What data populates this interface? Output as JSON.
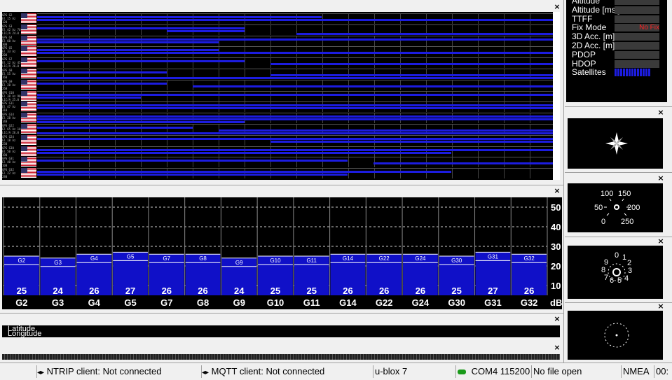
{
  "colors": {
    "signal_bar": "#1c1ce0",
    "snr_bar": "#1010c8",
    "fix_warning": "#ff2020",
    "background": "#000000"
  },
  "timeline": {
    "rows": [
      {
        "name": "GPS G2",
        "lines": [
          "GPS G2",
          "El 15 Az 120",
          "L1C/A 25.0"
        ],
        "bars": [
          [
            0,
            0.55
          ],
          [
            0,
            1
          ]
        ]
      },
      {
        "name": "GPS G3",
        "lines": [
          "GPS G3",
          "El 42 Az 70",
          "L1C/A 24.0"
        ],
        "bars": [
          [
            0,
            0.4
          ],
          [
            0.25,
            0.4
          ],
          [
            0.5,
            1
          ]
        ]
      },
      {
        "name": "GPS G4",
        "lines": [
          "GPS G4",
          "El 60 Az 300",
          "L1C/A 26.0"
        ],
        "bars": [
          [
            0,
            1
          ],
          [
            0,
            0.35
          ]
        ]
      },
      {
        "name": "GPS G5",
        "lines": [
          "GPS G5",
          "El 33 Az 200",
          "L1C/A 27.0"
        ],
        "bars": [
          [
            0,
            0.35
          ],
          [
            0,
            1
          ]
        ]
      },
      {
        "name": "GPS G7",
        "lines": [
          "GPS G7",
          "El 12 Az 45",
          "L1C/A 26.0"
        ],
        "bars": [
          [
            0,
            0.4
          ],
          [
            0.45,
            1
          ]
        ]
      },
      {
        "name": "GPS G8",
        "lines": [
          "GPS G8",
          "El 55 Az 160",
          "L1C/A 26.0"
        ],
        "bars": [
          [
            0,
            0.25
          ],
          [
            0.45,
            1
          ],
          [
            0,
            1
          ]
        ]
      },
      {
        "name": "GPS G9",
        "lines": [
          "GPS G9",
          "El 20 Az 260",
          "L1C/A 24.0"
        ],
        "bars": [
          [
            0,
            0.25
          ],
          [
            0.3,
            1
          ]
        ]
      },
      {
        "name": "GPS G10",
        "lines": [
          "GPS G10",
          "El 38 Az 90",
          "L1C/A 25.0"
        ],
        "bars": [
          [
            0,
            1
          ],
          [
            0,
            0.2
          ]
        ]
      },
      {
        "name": "GPS G11",
        "lines": [
          "GPS G11",
          "El 47 Az 310",
          "L1C/A 25.0"
        ],
        "bars": [
          [
            0,
            1
          ],
          [
            0,
            1
          ]
        ]
      },
      {
        "name": "GPS G14",
        "lines": [
          "GPS G14",
          "El 28 Az 140",
          "L1C/A 26.0"
        ],
        "bars": [
          [
            0,
            1
          ],
          [
            0,
            1
          ],
          [
            0,
            0.4
          ]
        ]
      },
      {
        "name": "GPS G22",
        "lines": [
          "GPS G22",
          "El 65 Az 10",
          "L1C/A 26.0"
        ],
        "bars": [
          [
            0,
            0.3
          ],
          [
            0.35,
            1
          ],
          [
            0,
            1
          ]
        ]
      },
      {
        "name": "GPS G24",
        "lines": [
          "GPS G24",
          "El 18 Az 230",
          "L1C/A 26.0"
        ],
        "bars": [
          [
            0,
            1
          ],
          [
            0.45,
            1
          ]
        ]
      },
      {
        "name": "GPS G30",
        "lines": [
          "GPS G30",
          "El 50 Az 190",
          "L1C/A 25.0"
        ],
        "bars": [
          [
            0,
            1
          ],
          [
            0,
            0.8
          ]
        ]
      },
      {
        "name": "GPS G31",
        "lines": [
          "GPS G31",
          "El 40 Az 100",
          "L1C/A 27.0"
        ],
        "bars": [
          [
            0,
            0.6
          ],
          [
            0.65,
            1
          ]
        ]
      },
      {
        "name": "GPS G32",
        "lines": [
          "GPS G32",
          "El 22 Az 280",
          "L1C/A 26.0"
        ],
        "bars": [
          [
            0,
            0.8
          ],
          [
            0,
            0.6
          ]
        ]
      }
    ]
  },
  "chart_data": {
    "type": "bar",
    "categories": [
      "G2",
      "G3",
      "G4",
      "G5",
      "G7",
      "G8",
      "G9",
      "G10",
      "G11",
      "G14",
      "G22",
      "G24",
      "G30",
      "G31",
      "G32"
    ],
    "values": [
      25,
      24,
      26,
      27,
      26,
      26,
      24,
      25,
      25,
      26,
      26,
      26,
      25,
      27,
      26
    ],
    "bar_labels": [
      "G2",
      "G3",
      "G4",
      "G5",
      "G7",
      "G8",
      "G9",
      "G10",
      "G11",
      "G14",
      "G22",
      "G24",
      "G30",
      "G31",
      "G32"
    ],
    "ylabel": "dB",
    "yticks": [
      10,
      20,
      30,
      40,
      50
    ],
    "ylim": [
      5,
      55
    ],
    "grid": true
  },
  "info": {
    "rows": [
      {
        "label": "Altitude",
        "value": ""
      },
      {
        "label": "Altitude [msl]",
        "value": ""
      },
      {
        "label": "TTFF",
        "value": ""
      },
      {
        "label": "Fix Mode",
        "value": "No Fix"
      },
      {
        "label": "3D Acc. [m]",
        "value": ""
      },
      {
        "label": "2D Acc. [m]",
        "value": ""
      },
      {
        "label": "PDOP",
        "value": ""
      },
      {
        "label": "HDOP",
        "value": ""
      },
      {
        "label": "Satellites",
        "value": ""
      }
    ]
  },
  "speed_dial": {
    "ticks": [
      "100",
      "150",
      "50",
      "200",
      "0",
      "250"
    ]
  },
  "clock_dial": {
    "ticks": [
      "0",
      "1",
      "2",
      "3",
      "4",
      "5",
      "6",
      "7",
      "8",
      "9"
    ]
  },
  "position": {
    "latitude_label": "Latitude",
    "longitude_label": "Longitude"
  },
  "close_glyph": "×",
  "status_bar": {
    "ntrip": "NTRIP client: Not connected",
    "mqtt": "MQTT client: Not connected",
    "receiver": "u-blox 7",
    "port": "COM4 115200",
    "file": "No file open",
    "protocol": "NMEA",
    "time": "00:"
  }
}
